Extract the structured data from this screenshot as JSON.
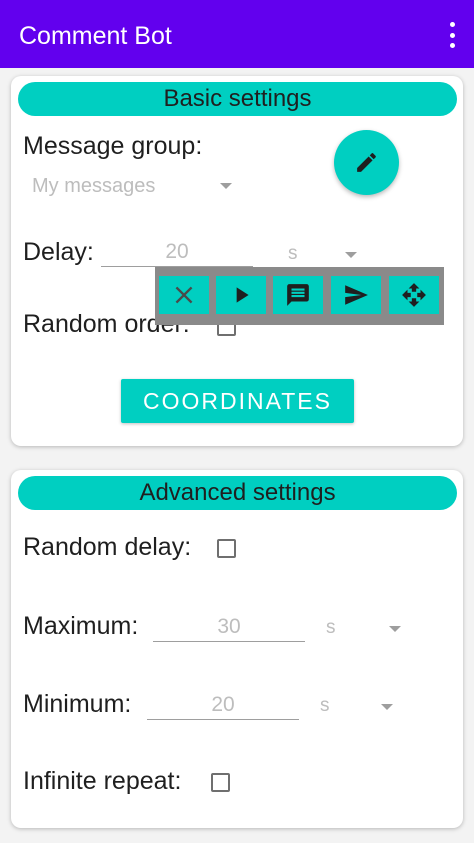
{
  "app": {
    "title": "Comment Bot",
    "menu_icon": "more-vert-icon"
  },
  "basic": {
    "header": "Basic settings",
    "message_group_label": "Message group:",
    "message_group_value": "My messages",
    "delay_label": "Delay:",
    "delay_value": "20",
    "delay_unit": "s",
    "random_order_label": "Random order:",
    "random_order_checked": false,
    "coordinates_button": "COORDINATES",
    "edit_icon": "pencil-icon"
  },
  "floating_toolbar": {
    "buttons": [
      "close-icon",
      "play-icon",
      "message-icon",
      "send-icon",
      "move-icon"
    ]
  },
  "advanced": {
    "header": "Advanced settings",
    "random_delay_label": "Random delay:",
    "random_delay_checked": false,
    "maximum_label": "Maximum:",
    "maximum_value": "30",
    "maximum_unit": "s",
    "minimum_label": "Minimum:",
    "minimum_value": "20",
    "minimum_unit": "s",
    "infinite_repeat_label": "Infinite repeat:",
    "infinite_repeat_checked": false
  },
  "colors": {
    "appbar": "#6200ee",
    "accent": "#00cfc1",
    "overlay": "#8a8a8a"
  }
}
